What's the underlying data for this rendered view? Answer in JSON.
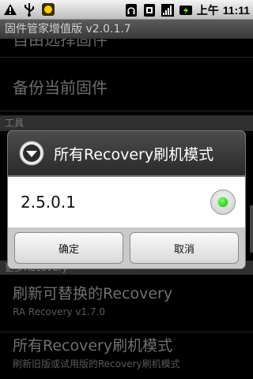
{
  "status_bar": {
    "icons_left": [
      "warning-icon",
      "usb-icon",
      "notification-icon"
    ],
    "icons_right": [
      "headset-icon",
      "sim-icon",
      "signal-icon",
      "battery-icon"
    ],
    "ampm": "上午",
    "time": "11:11"
  },
  "app_title": "固件管家增值版 v2.0.1.7",
  "list": {
    "partial_top": "自由选择固件",
    "backup_label": "备份当前固件",
    "section_tools": "工具",
    "section_more": "更多Recovery",
    "flash_title": "刷新可替换的Recovery",
    "flash_sub": "RA Recovery v1.7.0",
    "modes_title": "所有Recovery刷机模式",
    "modes_sub": "刷新旧版或试用版的Recovery刷机模式"
  },
  "dialog": {
    "title": "所有Recovery刷机模式",
    "option_value": "2.5.0.1",
    "option_selected": true,
    "ok_label": "确定",
    "cancel_label": "取消"
  },
  "colors": {
    "dialog_header": "#3a3a3a",
    "radio_selected": "#2fd11a"
  }
}
